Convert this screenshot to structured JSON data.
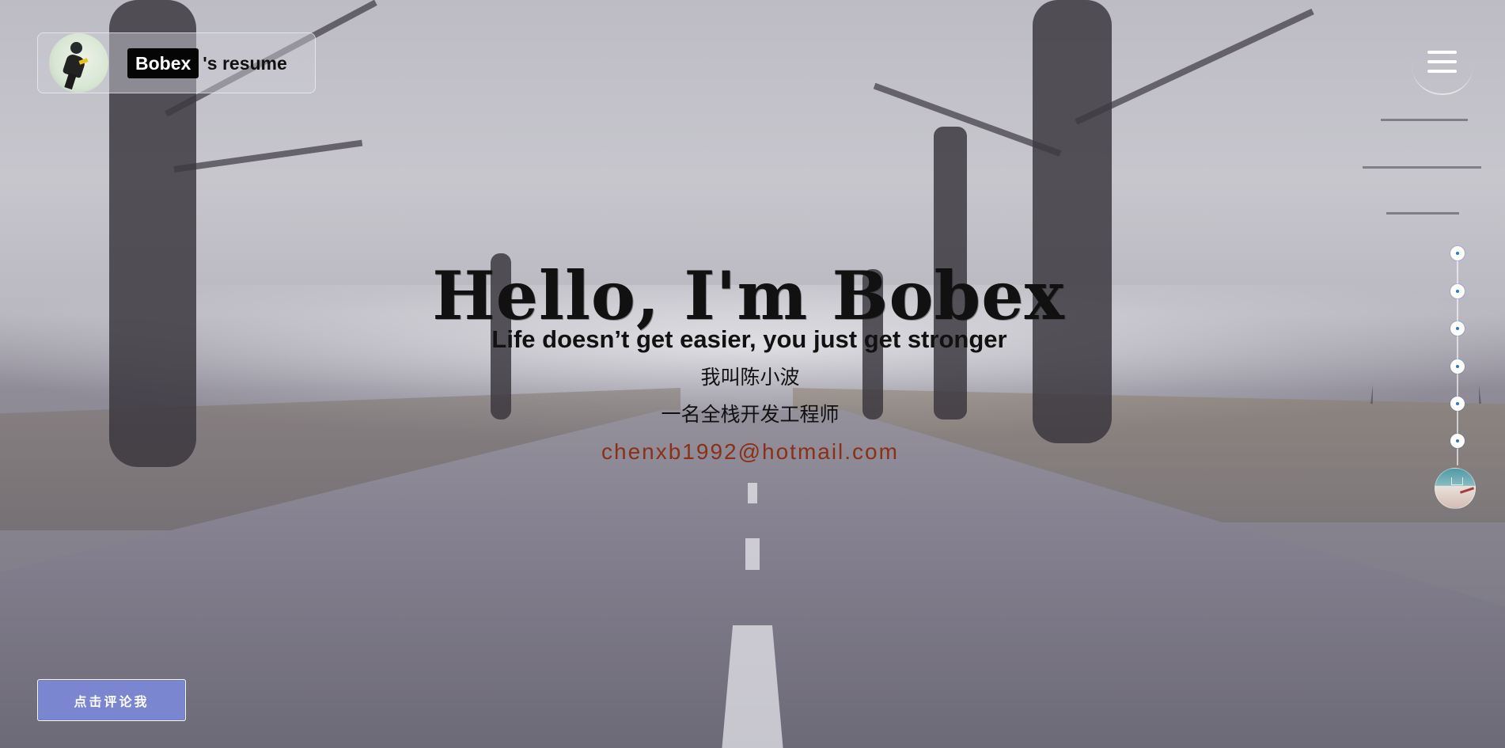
{
  "header": {
    "name": "Bobex",
    "suffix": "'s resume",
    "avatar_icon": "profile-avatar-icon",
    "menu_icon": "hamburger-menu-icon"
  },
  "hero": {
    "title": "Hello, I'm Bobex",
    "motto": "Life doesn’t get easier, you just get stronger",
    "name": "我叫陈小波",
    "role": "一名全栈开发工程师",
    "email": "chenxb1992@hotmail.com"
  },
  "section_nav": {
    "dots": [
      {
        "icon": "section-dot-icon"
      },
      {
        "icon": "section-dot-icon"
      },
      {
        "icon": "section-dot-icon"
      },
      {
        "icon": "section-dot-icon"
      },
      {
        "icon": "section-dot-icon"
      },
      {
        "icon": "section-dot-icon"
      }
    ],
    "music_icon": "music-player-avatar-icon"
  },
  "actions": {
    "comment_button": "点击评论我"
  },
  "colors": {
    "email": "#8b2f16",
    "comment_button": "#7a86d0",
    "nav_dot": "#2f78be",
    "brand_badge": "#050505"
  }
}
